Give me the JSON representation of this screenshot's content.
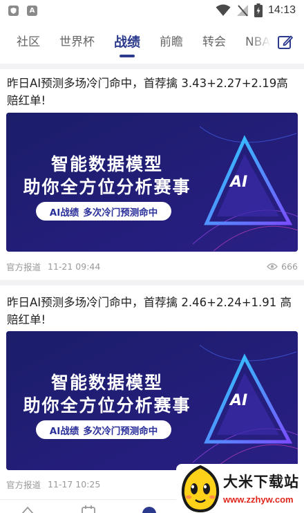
{
  "status_bar": {
    "time": "14:13",
    "left_icons": [
      "shield-icon",
      "a-letter-icon"
    ],
    "right_icons": [
      "wifi-icon",
      "no-signal-icon",
      "battery-icon"
    ]
  },
  "tabs": {
    "items": [
      "社区",
      "世界杯",
      "战绩",
      "前瞻",
      "转会",
      "NBA"
    ],
    "active": "战绩"
  },
  "articles": [
    {
      "title": "昨日AI预测多场冷门命中，首荐擒 3.43+2.27+2.19高赔红单!",
      "banner_line1": "智能数据模型",
      "banner_line2": "助你全方位分析赛事",
      "banner_pill_a": "AI战绩",
      "banner_pill_b": "多次冷门预测命中",
      "banner_logo": "AI",
      "source": "官方报道",
      "time": "11-21 09:44",
      "views": "666"
    },
    {
      "title": "昨日AI预测多场冷门命中，首荐擒 2.46+2.24+1.91 高赔红单!",
      "banner_line1": "智能数据模型",
      "banner_line2": "助你全方位分析赛事",
      "banner_pill_a": "AI战绩",
      "banner_pill_b": "多次冷门预测命中",
      "banner_logo": "AI",
      "source": "官方报道",
      "time": "11-17 10:25"
    }
  ],
  "watermark": {
    "title": "大米下载站",
    "url": "www.zzhyw.com"
  },
  "colors": {
    "accent": "#2b3a8c",
    "banner_bg": "#1c1f6f",
    "watermark_url": "#e0261c"
  }
}
